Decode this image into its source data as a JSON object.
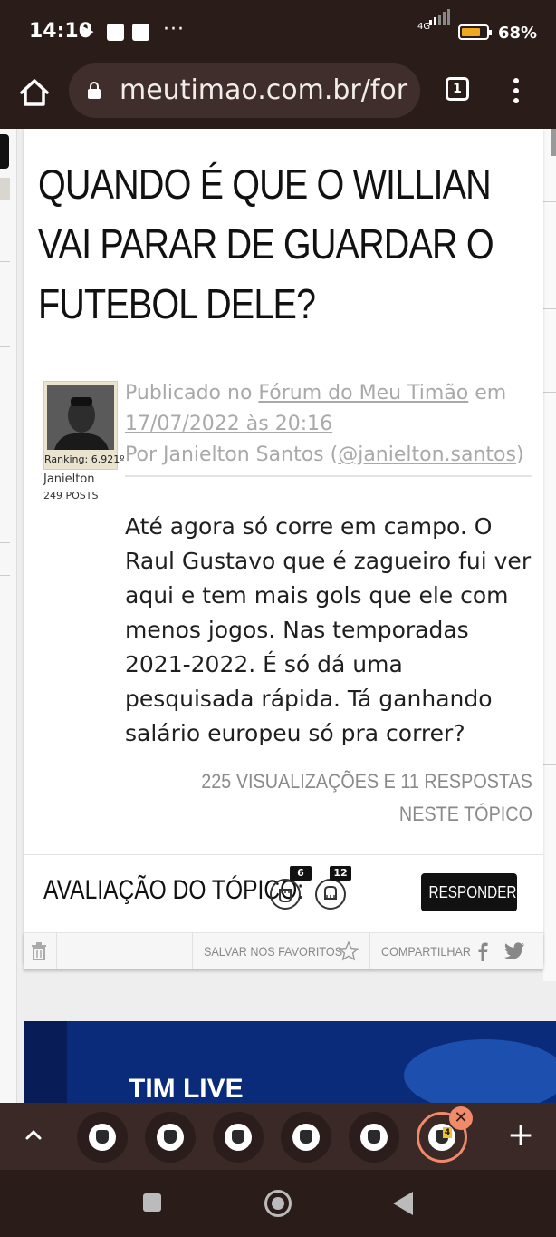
{
  "status_bar": {
    "time": "14:10",
    "network": "4G",
    "battery": "68%",
    "overflow": "···"
  },
  "browser": {
    "url": "meutimao.com.br/for",
    "tab_count": "1"
  },
  "topic": {
    "title": "QUANDO É QUE O WILLIAN VAI PARAR DE GUARDAR O FUTEBOL DELE?",
    "meta": {
      "published_prefix": "Publicado no ",
      "forum_link": "Fórum do Meu Timão",
      "in_word": " em ",
      "date_link": "17/07/2022 às 20:16",
      "by_prefix": "Por Janielton Santos (",
      "handle_link": "@janielton.santos",
      "by_suffix": ")"
    },
    "author": {
      "ranking": "Ranking: 6.921º",
      "name": "Janielton",
      "posts": "249 POSTS"
    },
    "body": "Até agora só corre em campo. O Raul Gustavo que é zagueiro fui ver aqui e tem mais gols que ele com menos jogos. Nas temporadas 2021-2022. É só dá uma pesquisada rápida. Tá ganhando salário europeu só pra correr?",
    "stats": "225 VISUALIZAÇÕES E 11 RESPOSTAS NESTE TÓPICO"
  },
  "rating": {
    "label": "AVALIAÇÃO DO TÓPICO:",
    "up_count": "6",
    "down_count": "12",
    "reply_button": "RESPONDER"
  },
  "actions": {
    "save_favorites": "SALVAR NOS FAVORITOS",
    "share": "COMPARTILHAR"
  },
  "ad": {
    "text": "TIM LIVE"
  },
  "tab_strip": {
    "active_badge": "4"
  }
}
